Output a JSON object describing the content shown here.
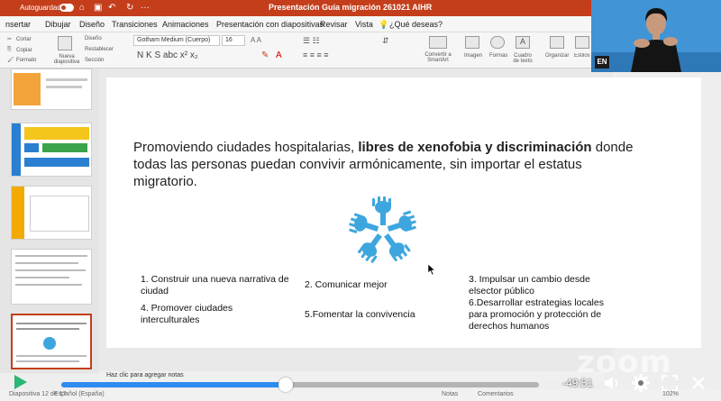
{
  "titlebar": {
    "autosave_label": "Autoguardado",
    "document_title": "Presentación Guía migración 261021 AIHR"
  },
  "menu": [
    "nsertar",
    "Dibujar",
    "Diseño",
    "Transiciones",
    "Animaciones",
    "Presentación con diapositivas",
    "Revisar",
    "Vista",
    "¿Qué deseas?"
  ],
  "ribbon": {
    "cut": "Cortar",
    "copy": "Copiar",
    "format": "Formato",
    "new_slide": "Nueva diapositiva",
    "layout": "Diseño",
    "reset": "Restablecer",
    "section": "Sección",
    "font_name": "Gotham Medium (Cuerpo)",
    "font_size": "16",
    "convert_smartart": "Convertir a SmartArt",
    "image": "Imagen",
    "shapes": "Formas",
    "text_box": "Cuadro de texto",
    "organize": "Organizar",
    "quick_styles": "Estilos rápidos"
  },
  "slide": {
    "title_plain": "Promoviendo ciudades hospitalarias,",
    "title_bold": "libres de xenofobia y discriminación",
    "title_rest": "donde todas las personas puedan convivir armónicamente, sin importar el estatus migratorio.",
    "items": [
      "1. Construir una nueva narrativa de ciudad",
      "2. Comunicar mejor",
      "3. Impulsar un cambio desde elsector público",
      "4. Promover ciudades interculturales",
      "5.Fomentar la convivencia",
      "6.Desarrollar estrategias locales para promoción y protección de derechos humanos"
    ]
  },
  "notes_placeholder": "Haz clic para agregar notas",
  "statusbar": {
    "slide_counter": "Diapositiva 12 de 17",
    "language": "Español (España)",
    "notes": "Notas",
    "comments": "Comentarios",
    "zoom": "102%"
  },
  "player": {
    "time": "-49:51",
    "progress": 0.47,
    "logo": "zoom"
  },
  "interpreter": {
    "language_badge": "EN"
  },
  "colors": {
    "ppt_accent": "#c43e1c",
    "hands_blue": "#3ea6de",
    "player_blue": "#2e8cf0"
  }
}
